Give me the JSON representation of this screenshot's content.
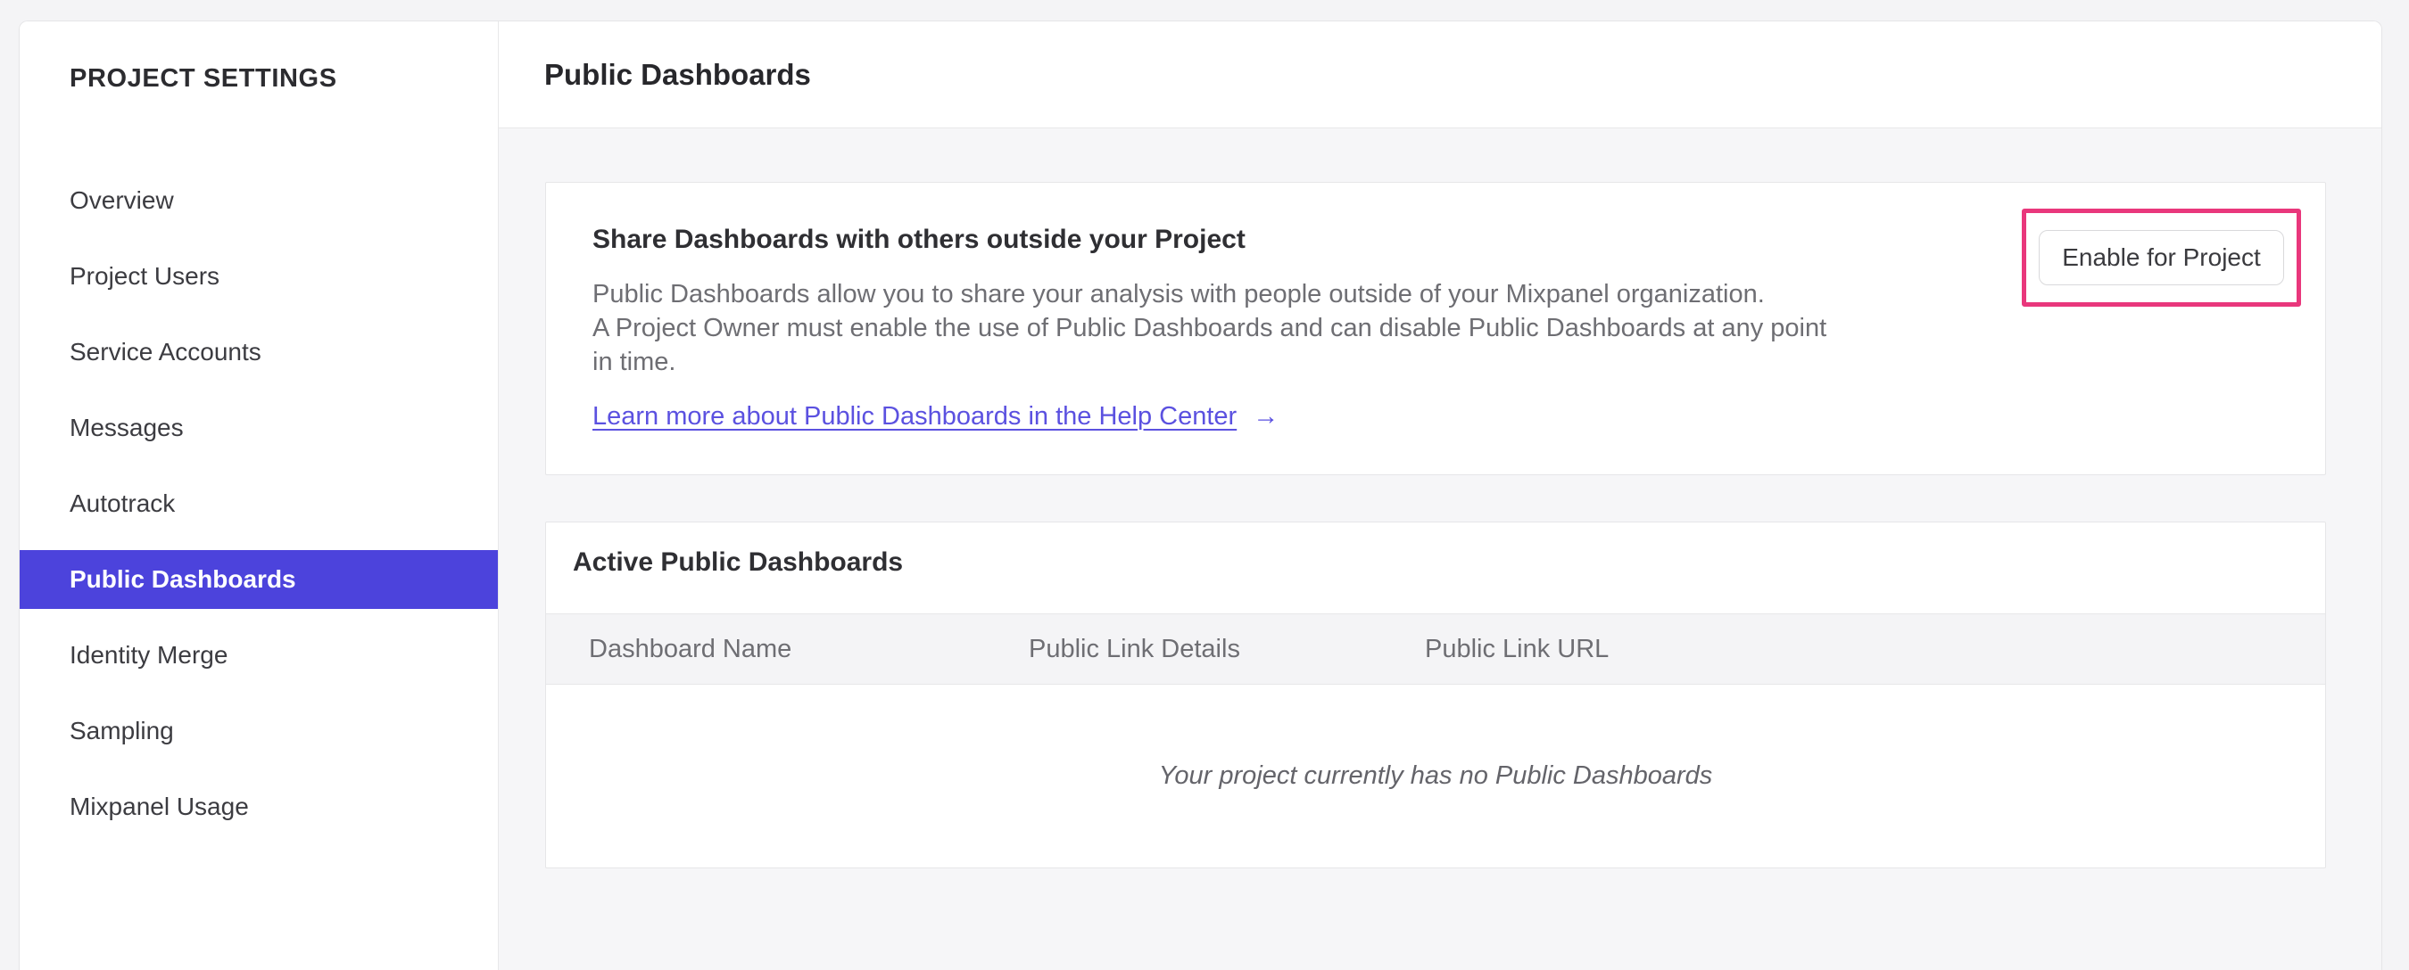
{
  "header": {
    "title": "Public Dashboards"
  },
  "sidebar": {
    "title": "PROJECT SETTINGS",
    "items": [
      {
        "label": "Overview",
        "active": false
      },
      {
        "label": "Project Users",
        "active": false
      },
      {
        "label": "Service Accounts",
        "active": false
      },
      {
        "label": "Messages",
        "active": false
      },
      {
        "label": "Autotrack",
        "active": false
      },
      {
        "label": "Public Dashboards",
        "active": true
      },
      {
        "label": "Identity Merge",
        "active": false
      },
      {
        "label": "Sampling",
        "active": false
      },
      {
        "label": "Mixpanel Usage",
        "active": false
      }
    ]
  },
  "cards": {
    "share": {
      "heading": "Share Dashboards with others outside your Project",
      "body_lines": [
        "Public Dashboards allow you to share your analysis with people outside of your Mixpanel organization.",
        "A Project Owner must enable the use of Public Dashboards and can disable Public Dashboards at any point",
        "in time."
      ],
      "link_label": "Learn more about Public Dashboards in the Help Center",
      "link_arrow": "→",
      "button_label": "Enable for Project"
    },
    "active": {
      "title": "Active Public Dashboards",
      "columns": [
        "Dashboard Name",
        "Public Link Details",
        "Public Link URL"
      ],
      "empty_message": "Your project currently has no Public Dashboards"
    }
  },
  "colors": {
    "accent_purple": "#4c43dc",
    "link_purple": "#5b51e0",
    "annotation_pink": "#e9377c"
  }
}
